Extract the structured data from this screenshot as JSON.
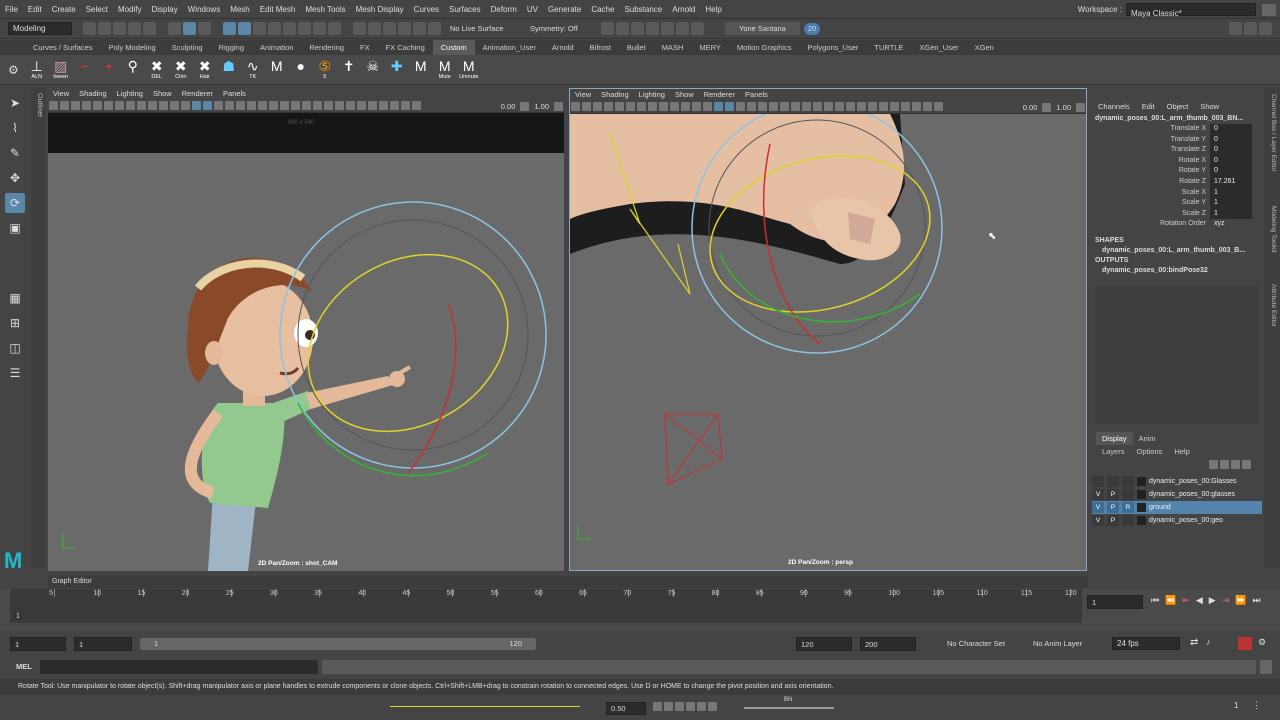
{
  "menubar": {
    "items": [
      "File",
      "Edit",
      "Create",
      "Select",
      "Modify",
      "Display",
      "Windows",
      "Mesh",
      "Edit Mesh",
      "Mesh Tools",
      "Mesh Display",
      "Curves",
      "Surfaces",
      "Deform",
      "UV",
      "Generate",
      "Cache",
      "Substance",
      "Arnold",
      "Help"
    ],
    "workspace_label": "Workspace :",
    "workspace_value": "Maya Classic*"
  },
  "statusline": {
    "mode": "Modeling",
    "live_surface": "No Live Surface",
    "symmetry": "Symmetry: Off",
    "user": "Yone Santana",
    "notifications": "20"
  },
  "shelf_tabs": [
    "Curves / Surfaces",
    "Poly Modeling",
    "Sculpting",
    "Rigging",
    "Animation",
    "Rendering",
    "FX",
    "FX Caching",
    "Custom",
    "Animation_User",
    "Arnold",
    "Bifrost",
    "Bullet",
    "MASH",
    "MERY",
    "Motion Graphics",
    "Polygons_User",
    "TURTLE",
    "XGen_User",
    "XGen"
  ],
  "shelf_active": "Custom",
  "shelf_buttons": [
    {
      "icon": "align-icon",
      "label": "ALN"
    },
    {
      "icon": "image-icon",
      "label": "tween"
    },
    {
      "icon": "minus-icon",
      "label": ""
    },
    {
      "icon": "plus-icon",
      "label": ""
    },
    {
      "icon": "key-icon",
      "label": ""
    },
    {
      "icon": "delete-key-icon",
      "label": "DEL"
    },
    {
      "icon": "chin-icon",
      "label": "Chin"
    },
    {
      "icon": "hair-icon",
      "label": "Hair"
    },
    {
      "icon": "ghost-icon",
      "label": ""
    },
    {
      "icon": "wave-icon",
      "label": "TK"
    },
    {
      "icon": "m-icon",
      "label": ""
    },
    {
      "icon": "camera-icon",
      "label": ""
    },
    {
      "icon": "five-icon",
      "label": "5"
    },
    {
      "icon": "t-pose-icon",
      "label": ""
    },
    {
      "icon": "skull-icon",
      "label": ""
    },
    {
      "icon": "cross-icon",
      "label": ""
    },
    {
      "icon": "m-icon",
      "label": ""
    },
    {
      "icon": "mute-icon",
      "label": "Mute"
    },
    {
      "icon": "unmute-icon",
      "label": "Unmute"
    }
  ],
  "outliner_tab": "Outliner",
  "viewport_left": {
    "menus": [
      "View",
      "Shading",
      "Lighting",
      "Show",
      "Renderer",
      "Panels"
    ],
    "val1": "0.00",
    "val2": "1.00",
    "resolution": "960 x 540",
    "label": "2D Pan/Zoom : shot_CAM"
  },
  "viewport_right": {
    "menus": [
      "View",
      "Shading",
      "Lighting",
      "Show",
      "Renderer",
      "Panels"
    ],
    "val1": "0.00",
    "val2": "1.00",
    "label": "2D Pan/Zoom : persp"
  },
  "channel_box": {
    "menus": [
      "Channels",
      "Edit",
      "Object",
      "Show"
    ],
    "node": "dynamic_poses_00:L_arm_thumb_003_BN...",
    "attributes": [
      {
        "name": "Translate X",
        "value": "0"
      },
      {
        "name": "Translate Y",
        "value": "0"
      },
      {
        "name": "Translate Z",
        "value": "0"
      },
      {
        "name": "Rotate X",
        "value": "0"
      },
      {
        "name": "Rotate Y",
        "value": "0"
      },
      {
        "name": "Rotate Z",
        "value": "17.261"
      },
      {
        "name": "Scale X",
        "value": "1"
      },
      {
        "name": "Scale Y",
        "value": "1"
      },
      {
        "name": "Scale Z",
        "value": "1"
      },
      {
        "name": "Rotation Order",
        "value": "xyz"
      }
    ],
    "shapes_label": "SHAPES",
    "shape": "dynamic_poses_00:L_arm_thumb_003_B...",
    "outputs_label": "OUTPUTS",
    "output": "dynamic_poses_00:bindPose32"
  },
  "side_tabs": [
    "Channel Box / Layer Editor",
    "Modeling Toolkit",
    "Attribute Editor"
  ],
  "layer_editor": {
    "tabs": [
      "Display",
      "Anim"
    ],
    "menus": [
      "Layers",
      "Options",
      "Help"
    ],
    "layers": [
      {
        "v": "",
        "p": "",
        "r": "",
        "name": "dynamic_poses_00:Glasses",
        "selected": false
      },
      {
        "v": "V",
        "p": "P",
        "r": "",
        "name": "dynamic_poses_00:glasses",
        "selected": false
      },
      {
        "v": "V",
        "p": "P",
        "r": "R",
        "name": "ground",
        "selected": true
      },
      {
        "v": "V",
        "p": "P",
        "r": "",
        "name": "dynamic_poses_00:geo",
        "selected": false
      }
    ]
  },
  "graph_editor_label": "Graph Editor",
  "timeslider": {
    "ticks": [
      "5",
      "10",
      "15",
      "20",
      "25",
      "30",
      "35",
      "40",
      "45",
      "50",
      "55",
      "60",
      "65",
      "70",
      "75",
      "80",
      "85",
      "90",
      "95",
      "100",
      "105",
      "110",
      "115",
      "120"
    ],
    "current": "1",
    "current_frame_field": "1"
  },
  "range": {
    "start": "1",
    "playback_start": "1",
    "slider_start": "1",
    "slider_end": "120",
    "playback_end": "120",
    "end": "200",
    "character_set": "No Character Set",
    "anim_layer": "No Anim Layer",
    "fps": "24 fps"
  },
  "cmdline": {
    "label": "MEL"
  },
  "helpline": "Rotate Tool: Use manipulator to rotate object(s). Shift+drag manipulator axis or plane handles to extrude components or clone objects. Ctrl+Shift+LMB+drag to constrain rotation to connected edges. Use D or HOME to change the pivot position and axis orientation.",
  "bottombar": {
    "value": "0.50",
    "bn": "BN",
    "one": "1"
  }
}
